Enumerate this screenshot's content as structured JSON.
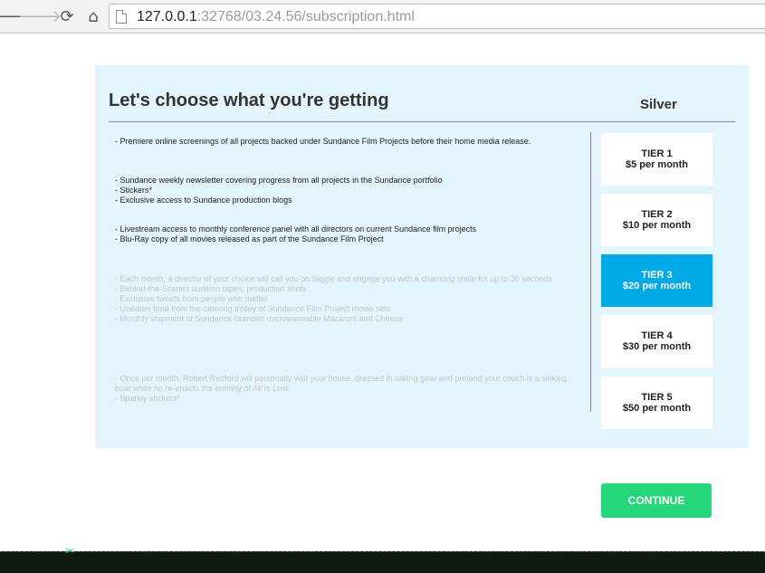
{
  "browser": {
    "url_host": "127.0.0.1",
    "url_rest": ":32768/03.24.56/subscription.html",
    "icons": [
      "back-arrow-icon",
      "forward-arrow-icon",
      "reload-icon",
      "home-icon",
      "page-icon"
    ]
  },
  "panel": {
    "title": "Let's choose what you're getting",
    "plan_name": "Silver"
  },
  "features": {
    "group1": [
      "- Premiere online screenings of all projects backed under Sundance Film Projects before their home media release."
    ],
    "group2": [
      "- Sundance weekly newsletter covering progress from all projects in the Sundance portfolio",
      "- Stickers*",
      "- Exclusive access to Sundance production blogs"
    ],
    "group3": [
      "- Livestream access to monthly conference panel with all directors on current Sundance film projects",
      "- Blu-Ray copy of all movies released as part of the Sundance Film Project"
    ],
    "group4": [
      "- Each month, a director of your choice will call you on Skype and engage you with a charming smile for up to 30 seconds",
      "- Behind-the-Scenes audition tapes, production shots",
      "- Exclusive tweets from people who matter",
      "- Uneaten food from the catering trolley of Sundance Film Project movie sets",
      "- Monthly shipment of Sundance-branded microwaveable Macaroni and Cheese"
    ],
    "group5": [
      "- Once per month, Robert Redford will personally visit your house, dressed in sailing gear and pretend your couch is a sinking boat while he re-enacts the entirety of All Is Lost.",
      "- Sparkly stickers*"
    ]
  },
  "tiers": [
    {
      "name": "TIER 1",
      "price": "$5 per month"
    },
    {
      "name": "TIER 2",
      "price": "$10 per month"
    },
    {
      "name": "TIER 3",
      "price": "$20 per month"
    },
    {
      "name": "TIER 4",
      "price": "$30 per month"
    },
    {
      "name": "TIER 5",
      "price": "$50 per month"
    }
  ],
  "selected_tier": "TIER 3",
  "continue_label": "CONTINUE",
  "colors": {
    "panel_bg": "#e3f4fc",
    "selected_tier": "#00aae6",
    "continue_button": "#26d67a",
    "footer": "#0e1a10"
  }
}
